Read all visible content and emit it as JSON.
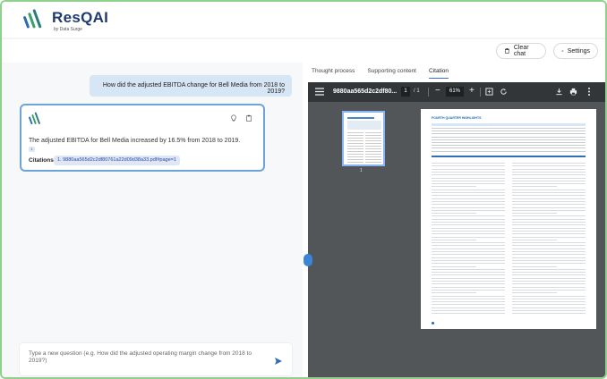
{
  "app": {
    "brand": "ResQAI",
    "brand_sub": "by Data Surge"
  },
  "header": {
    "clear_label": "Clear chat",
    "settings_label": "Settings"
  },
  "chat": {
    "user_question": "How did the adjusted EBITDA change for Bell Media from 2018 to 2019?",
    "answer": "The adjusted EBITDA for Bell Media increased by 16.5% from 2018 to 2019.",
    "answer_tag": "1",
    "citations_label": "Citations:",
    "citation": "1. 9880aa565d2c2df80761a22d09d38a33.pdf#page=1",
    "input_placeholder": "Type a new question (e.g. How did the adjusted operating margin change from 2018 to 2019?)"
  },
  "tabs": [
    {
      "label": "Thought process",
      "active": false
    },
    {
      "label": "Supporting content",
      "active": false
    },
    {
      "label": "Citation",
      "active": true
    }
  ],
  "viewer": {
    "file_name": "9880aa565d2c2df80...",
    "page": "1",
    "total": "/ 1",
    "zoom": "61%",
    "thumb_number": "1",
    "doc_title": "FOURTH QUARTER HIGHLIGHTS"
  },
  "colors": {
    "frame_border": "#8fd08a",
    "brand": "#1f3b6e",
    "accent": "#3a6fd8",
    "user_bubble": "#d6e6f4",
    "card_border": "#6ea3d8"
  }
}
